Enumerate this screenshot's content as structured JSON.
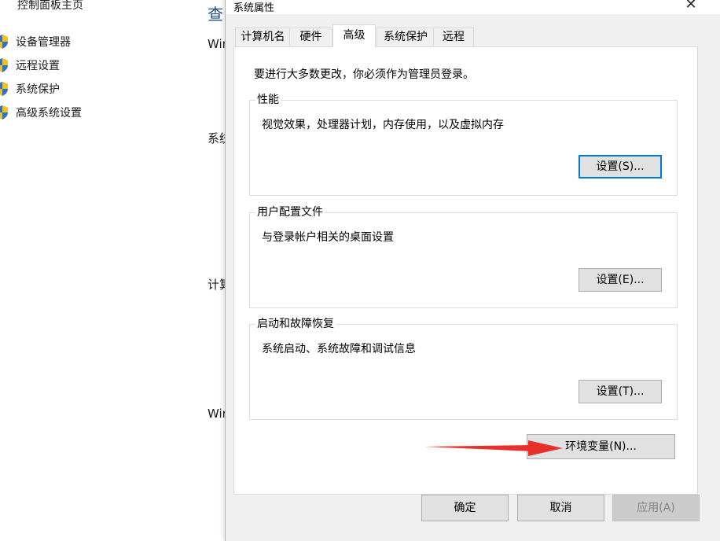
{
  "background": {
    "home_link": "控制面板主页",
    "sidebar": [
      {
        "label": "设备管理器"
      },
      {
        "label": "远程设置"
      },
      {
        "label": "系统保护"
      },
      {
        "label": "高级系统设置"
      }
    ],
    "title_fragment": "查",
    "fragments": [
      "Wir",
      "系统",
      "计算",
      "Wir"
    ]
  },
  "dialog": {
    "title": "系统属性",
    "close_glyph": "✕",
    "tabs": [
      {
        "label": "计算机名",
        "active": false
      },
      {
        "label": "硬件",
        "active": false
      },
      {
        "label": "高级",
        "active": true
      },
      {
        "label": "系统保护",
        "active": false
      },
      {
        "label": "远程",
        "active": false
      }
    ],
    "notice": "要进行大多数更改，你必须作为管理员登录。",
    "groups": [
      {
        "title": "性能",
        "description": "视觉效果，处理器计划，内存使用，以及虚拟内存",
        "button": "设置(S)..."
      },
      {
        "title": "用户配置文件",
        "description": "与登录帐户相关的桌面设置",
        "button": "设置(E)..."
      },
      {
        "title": "启动和故障恢复",
        "description": "系统启动、系统故障和调试信息",
        "button": "设置(T)..."
      }
    ],
    "env_button": "环境变量(N)...",
    "ok_button": "确定",
    "cancel_button": "取消",
    "apply_button": "应用(A)"
  },
  "colors": {
    "accent_focus": "#0078d7",
    "annotation_arrow": "#e8302a",
    "shield_blue": "#2d6fd6",
    "shield_yellow": "#f2c40f"
  },
  "icons": {
    "sidebar": "uac-shield-icon",
    "annotation": "red-arrow-icon"
  }
}
